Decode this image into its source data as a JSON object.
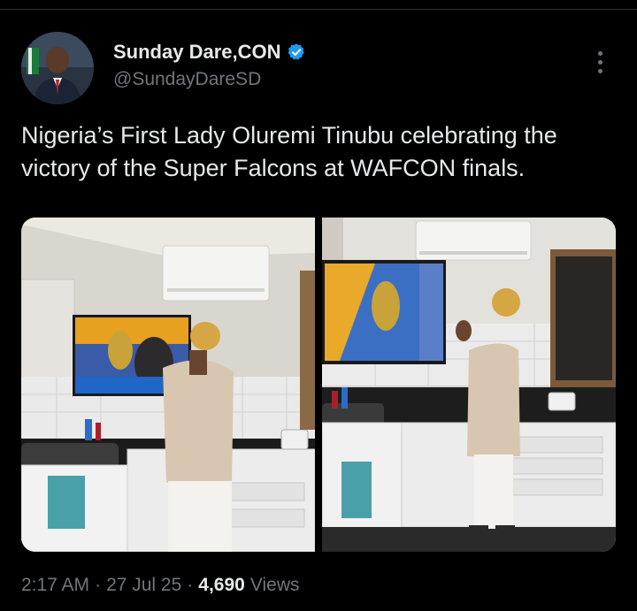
{
  "author": {
    "display_name": "Sunday Dare,CON",
    "handle": "@SundayDareSD",
    "verified": true,
    "verified_color": "#1d9bf0"
  },
  "tweet": {
    "text": "Nigeria’s First Lady Oluremi Tinubu celebrating the victory of the Super Falcons at WAFCON finals."
  },
  "media": {
    "photos": [
      {
        "description_icon": "photo-first-lady-watching-tv-left"
      },
      {
        "description_icon": "photo-first-lady-clapping-right"
      }
    ]
  },
  "meta": {
    "time": "2:17 AM",
    "separator1": "·",
    "date": "27 Jul 25",
    "separator2": "·",
    "views_count": "4,690",
    "views_label": "Views"
  },
  "icons": {
    "more": "more-vertical-icon",
    "verified": "verified-badge-icon"
  }
}
